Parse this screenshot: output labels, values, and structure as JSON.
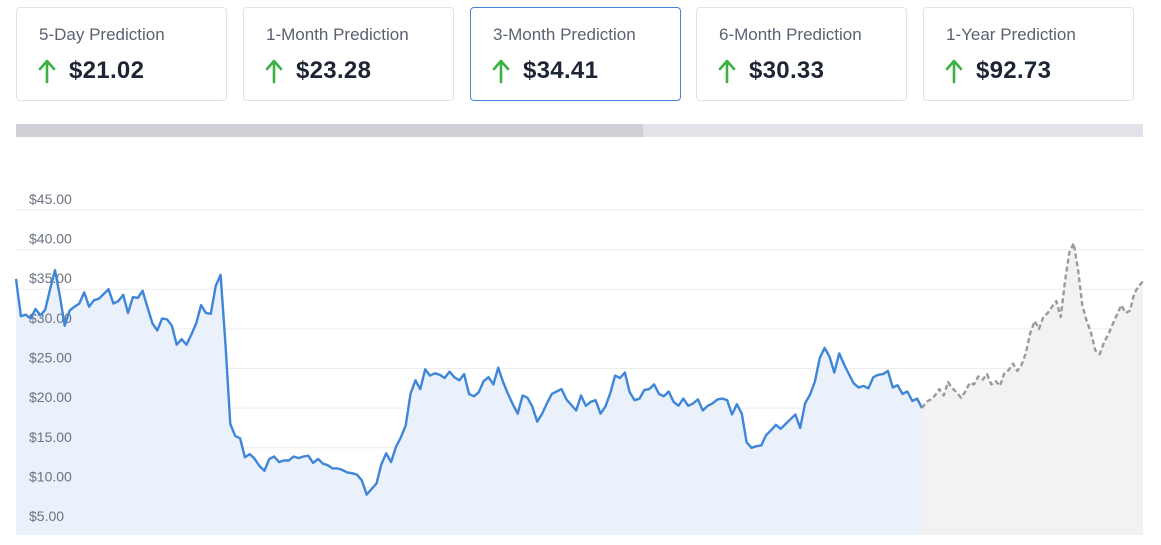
{
  "cards": [
    {
      "label": "5-Day Prediction",
      "value": "21.02",
      "currency": "$",
      "direction": "up",
      "active": false
    },
    {
      "label": "1-Month Prediction",
      "value": "23.28",
      "currency": "$",
      "direction": "up",
      "active": false
    },
    {
      "label": "3-Month Prediction",
      "value": "34.41",
      "currency": "$",
      "direction": "up",
      "active": true
    },
    {
      "label": "6-Month Prediction",
      "value": "30.33",
      "currency": "$",
      "direction": "up",
      "active": false
    },
    {
      "label": "1-Year Prediction",
      "value": "92.73",
      "currency": "$",
      "direction": "up",
      "active": false
    }
  ],
  "progress": {
    "fraction": 0.556
  },
  "colors": {
    "accent": "#4a82d6",
    "up_arrow": "#3cb043",
    "history_line": "#3f86d8",
    "history_fill": "#eaf1fb",
    "forecast_line": "#9a9a9a",
    "forecast_fill": "#f2f2f2",
    "grid": "#ececec"
  },
  "chart_data": {
    "type": "area",
    "yticks": [
      "$45.00",
      "$40.00",
      "$35.00",
      "$30.00",
      "$25.00",
      "$20.00",
      "$15.00",
      "$10.00",
      "$5.00"
    ],
    "ylim": [
      4,
      46
    ],
    "grid": true,
    "series": [
      {
        "style": "solid",
        "values": [
          36.3,
          31.6,
          31.8,
          31.3,
          32.5,
          31.7,
          32.4,
          35.0,
          37.4,
          34.2,
          30.4,
          32.3,
          32.8,
          33.2,
          34.6,
          32.8,
          33.6,
          33.8,
          34.4,
          35.0,
          33.2,
          33.5,
          34.3,
          32.0,
          34.0,
          33.9,
          34.8,
          32.7,
          30.7,
          29.8,
          31.3,
          31.2,
          30.4,
          28.0,
          28.7,
          28.0,
          29.3,
          30.7,
          33.0,
          32.0,
          31.9,
          35.4,
          36.8,
          28.0,
          18.0,
          16.5,
          16.2,
          13.8,
          14.2,
          13.6,
          12.7,
          12.1,
          13.6,
          13.9,
          13.2,
          13.4,
          13.4,
          13.9,
          13.7,
          13.9,
          14.0,
          13.1,
          13.6,
          13.0,
          12.8,
          12.4,
          12.4,
          12.2,
          11.9,
          11.8,
          11.6,
          10.9,
          9.1,
          9.8,
          10.5,
          12.9,
          14.3,
          13.2,
          15.1,
          16.3,
          17.8,
          21.8,
          23.5,
          22.4,
          24.9,
          24.1,
          24.4,
          24.2,
          23.8,
          24.6,
          23.9,
          23.5,
          24.3,
          21.8,
          21.5,
          22.0,
          23.4,
          23.9,
          23.0,
          25.1,
          23.3,
          21.8,
          20.5,
          19.3,
          21.6,
          21.3,
          20.2,
          18.3,
          19.3,
          20.6,
          21.8,
          22.1,
          22.4,
          21.1,
          20.4,
          19.7,
          21.6,
          20.3,
          20.8,
          21.0,
          19.3,
          20.2,
          21.9,
          24.1,
          23.8,
          24.5,
          22.0,
          21.0,
          21.2,
          22.3,
          22.4,
          23.0,
          21.8,
          21.5,
          22.1,
          20.8,
          20.3,
          21.2,
          20.3,
          20.6,
          21.1,
          19.7,
          20.3,
          20.6,
          21.1,
          21.2,
          21.0,
          19.2,
          20.5,
          19.3,
          15.7,
          15.0,
          15.2,
          15.3,
          16.6,
          17.2,
          17.9,
          17.4,
          18.0,
          18.6,
          19.2,
          17.5,
          20.6,
          21.7,
          23.3,
          26.3,
          27.6,
          26.5,
          24.5,
          26.9,
          25.5,
          24.3,
          23.1,
          22.6,
          22.8,
          22.5,
          23.9,
          24.2,
          24.3,
          24.7,
          22.6,
          22.9,
          21.8,
          22.1,
          20.9,
          21.2,
          20.0
        ]
      },
      {
        "style": "dashed",
        "values": [
          20.0,
          20.8,
          21.1,
          21.6,
          22.4,
          21.6,
          23.3,
          22.5,
          22.0,
          21.3,
          22.1,
          23.2,
          23.0,
          24.0,
          23.6,
          24.3,
          23.0,
          23.4,
          22.8,
          24.4,
          24.8,
          25.6,
          24.7,
          25.5,
          27.0,
          29.5,
          31.0,
          30.0,
          31.5,
          32.0,
          32.8,
          33.5,
          31.5,
          36.0,
          39.6,
          40.8,
          37.5,
          33.0,
          31.0,
          29.5,
          27.3,
          26.8,
          28.3,
          29.3,
          30.6,
          31.8,
          33.0,
          32.0,
          32.3,
          34.5,
          35.4,
          36.0
        ]
      }
    ]
  }
}
